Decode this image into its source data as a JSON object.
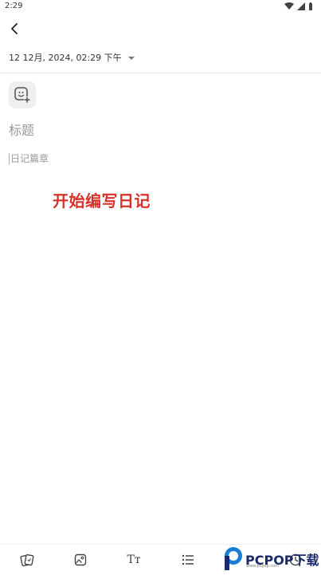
{
  "status_bar": {
    "time": "2:29"
  },
  "header": {
    "date_text": "12 12月, 2024, 02:29 下午"
  },
  "editor": {
    "title_placeholder": "标题",
    "body_placeholder": "日记篇章"
  },
  "overlay": {
    "caption": "开始编写日记"
  },
  "toolbar": {
    "items": [
      {
        "icon": "cards-icon"
      },
      {
        "icon": "image-icon"
      },
      {
        "icon": "text-size-icon",
        "label": "Tт"
      },
      {
        "icon": "list-icon"
      },
      {
        "icon": "clock-icon"
      }
    ]
  },
  "watermark": {
    "brand": "PCPOP下载",
    "sub": "www.pcpop.com"
  },
  "colors": {
    "accent_red": "#d7322a",
    "placeholder": "#9a9a9a",
    "logo_blue": "#1a2b6b"
  }
}
